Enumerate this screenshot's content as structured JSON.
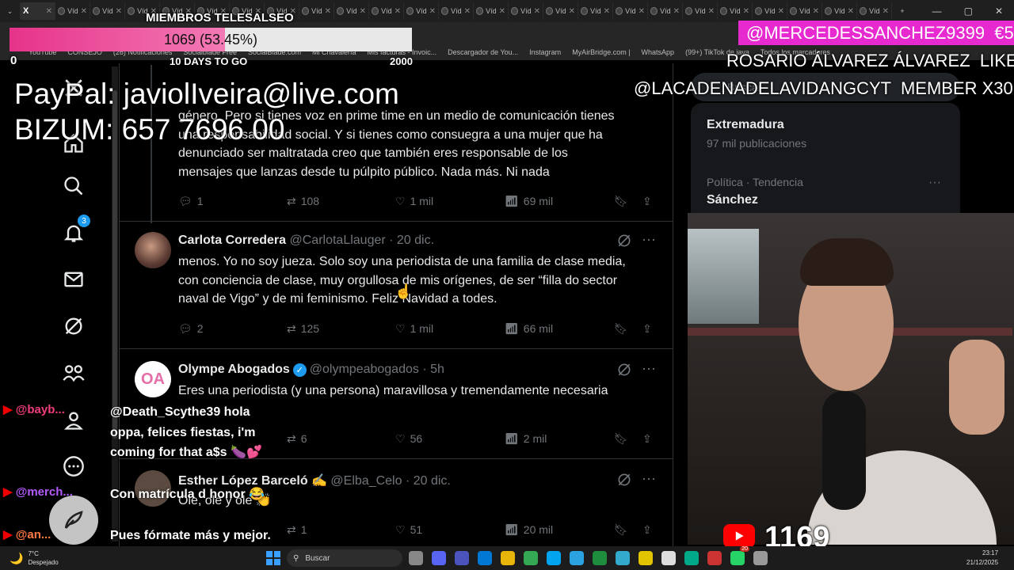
{
  "browser": {
    "active_tab_icon": "X",
    "tab_label": "Víd",
    "tab_count": 24,
    "new_tab": "+",
    "bookmarks": [
      "YouTube",
      "CONSEJO",
      "(26) Notificaciones",
      "Socialblade Free",
      "SocialBlade.com",
      "Mi Chavalería",
      "Mis facturas - Invoic...",
      "Descargador de You...",
      "Instagram",
      "MyAirBridge.com |",
      "WhatsApp",
      "(99+) TikTok de java",
      "Todos los marcadores"
    ]
  },
  "overlay": {
    "goal_title": "MIEMBROS TELESALSEO",
    "goal_value": "1069 (53.45%)",
    "goal_progress": 0.5345,
    "goal_min": "0",
    "goal_max": "2000",
    "goal_sub": "10 DAYS TO GO",
    "paypal": "PayPal: javiolIveira@live.com",
    "bizum": "BIZUM: 657 7696 00",
    "donation": "@MERCEDESSANCHEZ9399  €5",
    "ticker1": "ROSARIO ÁLVAREZ ÁLVAREZ  LIKE",
    "ticker2": "@LACADENADELAVIDANGCYT  MEMBER X30",
    "yt_count": "1169"
  },
  "nav": {
    "notifications_badge": "3",
    "items": [
      "x-logo",
      "home",
      "search",
      "notifications",
      "messages",
      "grok",
      "communities",
      "profile",
      "more"
    ]
  },
  "tweets": [
    {
      "text_lines": [
        "género. Pero si tienes voz en prime time en un medio de comunicación tienes",
        "una responsabilidad social. Y si tienes como consuegra a una mujer que ha",
        "denunciado ser maltratada creo que también eres responsable de los",
        "mensajes que lanzas desde tu púlpito público. Nada más. Ni nada"
      ],
      "replies": "1",
      "retweets": "108",
      "likes": "1 mil",
      "views": "69 mil"
    },
    {
      "name": "Carlota Corredera",
      "handle": "@CarlotaLlauger · 20 dic.",
      "text_lines": [
        "menos. Yo no soy jueza. Solo soy una periodista de una familia de clase media,",
        "con conciencia de clase, muy orgullosa de mis orígenes, de ser “filla do sector",
        "naval de Vigo” y de mi feminismo. Feliz Navidad a todes."
      ],
      "replies": "2",
      "retweets": "125",
      "likes": "1 mil",
      "views": "66 mil"
    },
    {
      "name": "Olympe Abogados",
      "handle": "@olympeabogados · 5h",
      "avatar_text": "OA",
      "text_lines": [
        "Eres una periodista (y una persona) maravillosa y tremendamente necesaria"
      ],
      "retweets": "6",
      "likes": "56",
      "views": "2 mil"
    },
    {
      "name": "Esther López Barceló ✍️",
      "handle": "@Elba_Celo · 20 dic.",
      "text_lines": [
        "Ole, ole y ole 👏"
      ],
      "retweets": "1",
      "likes": "51",
      "views": "20 mil"
    }
  ],
  "sidebar": {
    "search_placeholder": "Buscar",
    "trend1_name": "Extremadura",
    "trend1_count": "97 mil publicaciones",
    "trend2_category": "Política · Tendencia",
    "trend2_name": "Sánchez"
  },
  "chat": [
    {
      "user": "@bayb...",
      "msg": "@Death_Scythe39 hola oppa, felices fiestas, i'm coming for that a$s 🍆💕"
    },
    {
      "user": "@merch...",
      "msg": "Con matrícula d honor 😂"
    },
    {
      "user": "@an...",
      "msg": "Pues fórmate más y mejor."
    }
  ],
  "taskbar": {
    "weather_temp": "7°C",
    "weather_desc": "Despejado",
    "search": "Buscar",
    "time": "23:17",
    "date": "21/12/2025",
    "badge": "20"
  }
}
